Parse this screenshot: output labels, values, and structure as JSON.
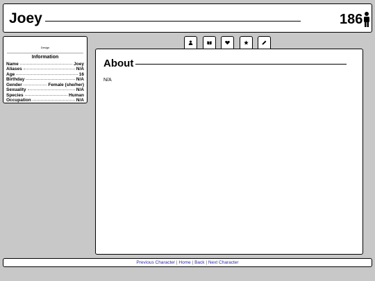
{
  "header": {
    "name": "Joey",
    "number": "186"
  },
  "sidebar": {
    "design_label": "Design",
    "info_title": "Information",
    "fields": [
      {
        "label": "Name",
        "value": "Joey"
      },
      {
        "label": "Aliases",
        "value": "N/A"
      },
      {
        "label": "Age",
        "value": "16"
      },
      {
        "label": "Birthday",
        "value": "N/A"
      },
      {
        "label": "Gender",
        "value": "Female (she/her)"
      },
      {
        "label": "Sexuality",
        "value": "N/A"
      },
      {
        "label": "Species",
        "value": "Human"
      },
      {
        "label": "Occupation",
        "value": "N/A"
      }
    ]
  },
  "tabs": [
    {
      "icon": "user-icon"
    },
    {
      "icon": "book-icon"
    },
    {
      "icon": "heart-icon"
    },
    {
      "icon": "star-icon"
    },
    {
      "icon": "pencil-icon"
    }
  ],
  "main": {
    "title": "About",
    "body": "N/A"
  },
  "footer": {
    "prev": "Previous Character",
    "home": "Home",
    "back": "Back",
    "next": "Next Character",
    "separator": "|"
  }
}
